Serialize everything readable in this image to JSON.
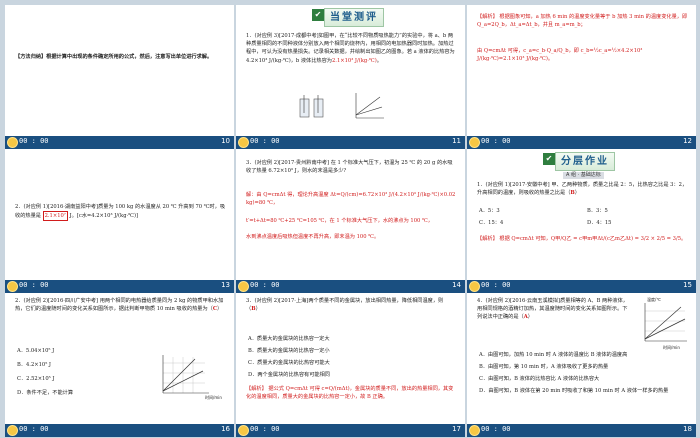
{
  "time": "00 : 00",
  "s10": {
    "num": "10",
    "text": "【方法归纳】根据计算中出现的条件确定所用的公式，然后，注意写出单位进行求解。"
  },
  "s11": {
    "num": "11",
    "banner": "当堂测评",
    "text": "1．(对应例 3)[2017·成都中考]如图甲，在“比较不同物质吸热能力”的实验中，将 a、b 两种质量相同的不同种液体分别放入两个相同的烧杯内，用相同的电加热器同时加热。加热过程中，可认为没有热量损失。记录相关数据，并绘制出如图乙的图象。若 a 液体的比热容为 4.2×10³ J/(kg·℃)，b 液体比热容为",
    "answer": "2.1×10³ J/(kg·℃)",
    "fig1": "甲",
    "fig2": "乙"
  },
  "s12": {
    "num": "12",
    "text1": "【解析】 根据图象可知，a 加热 6 min 的温度变化量等于 b 加热 3 min 的温度变化量，即 Q_a=2Q_b，Δt_a=Δt_b，并且 m_a=m_b；",
    "text2": "由 Q=cmΔt 可得，c_a=c_b·Q_a/Q_b，即 c_b=½c_a=½×4.2×10³ J/(kg·℃)=2.1×10³ J/(kg·℃)。"
  },
  "s13": {
    "num": "13",
    "text": "2．(对应例 1)[2016·湖南益阳中考]质量为 100 kg 的水温度从 20 ℃ 升高到 70 ℃时，吸收的热量是",
    "answer": "2.1×10⁷",
    "text2": "J。[c水=4.2×10³ J/(kg·℃)]"
  },
  "s14": {
    "num": "14",
    "text": "3．(对应例 2)[2017·贵州黔南中考] 在 1 个标准大气压下，初温为 25 ℃ 的 20 g 的水吸收了热量 6.72×10³ J，则水的末温是多少?",
    "sol1": "解：由 Q=cmΔt 得，理论升高温度 Δt=Q/(cm)=6.72×10³ J/(4.2×10³ J/(kg·℃)×0.02 kg)=80 ℃，",
    "sol2": "t′=t+Δt=80 ℃+25 ℃=105 ℃，在 1 个标准大气压下，水的沸点为 100 ℃，",
    "sol3": "水到沸点温度后吸热但温度不再升高，即末温为 100 ℃。"
  },
  "s15": {
    "num": "15",
    "banner": "分层作业",
    "tag": "A 组 · 基础达标",
    "text": "1．(对应例 1)[2017·安徽中考] 甲、乙两种物质，质量之比是 2：5，比热容之比是 3：2，升高相同的温度，则吸收的热量之比是（",
    "answer": "B",
    "opts": [
      "A．5：3",
      "B．3：5",
      "C．15：4",
      "D．4：15"
    ],
    "exp": "【解析】 根据 Q=cmΔt 可知，Q甲/Q乙 = c甲m甲Δt/(c乙m乙Δt) = 3/2 × 2/5 = 3/5。"
  },
  "s16": {
    "num": "16",
    "text": "2．(对应例 2)[2016·四川广安中考] 用两个相同的电热器给质量同为 2 kg 的物质甲和水加热，它们的温度随时间的变化关系如图所示，据此判断甲物质 10 min 吸收的热量为（",
    "answer": "C",
    "opts": [
      "A．5.04×10⁵ J",
      "B．4.2×10⁵ J",
      "C．2.52×10⁵ J",
      "D．条件不足，不能计算"
    ],
    "axisx": "时间/min",
    "axisy": "温度/℃"
  },
  "s17": {
    "num": "17",
    "text": "3．(对应例 2)[2017·上海]两个质量不同的金属块，放出相同热量，降低相同温度，则（",
    "answer": "B",
    "opts": [
      "A．质量大的金属块的比热容一定大",
      "B．质量大的金属块的比热容一定小",
      "C．质量大的金属块的比热容可能大",
      "D．两个金属块的比热容有可能相同"
    ],
    "exp": "【解析】 据公式 Q=cmΔt 可得 c=Q/(mΔt)，金属块的质量不同，放出的热量相同，其变化的温度相同，质量大的金属块的比热容一定小，故 B 正确。"
  },
  "s18": {
    "num": "18",
    "text": "4．(对应例 2)[2016·云南玉溪模拟]质量相等的 A、B 两种液体，用相同规格的酒精灯加热，其温度随时间的变化关系如图所示。下列说法中正确的是（",
    "answer": "A",
    "opts": [
      "A．由图可知，加热 10 min 时 A 液体的温度比 B 液体的温度高",
      "B．由图可知，第 10 min 时，A 液体吸收了更多的热量",
      "C．由图可知，B 液体的比热容比 A 液体的比热容大",
      "D．由图可知，B 液体在第 20 min 时吸收了和第 10 min 时 A 液体一样多的热量"
    ],
    "axisy": "温度/℃",
    "axisx": "时间/min"
  }
}
